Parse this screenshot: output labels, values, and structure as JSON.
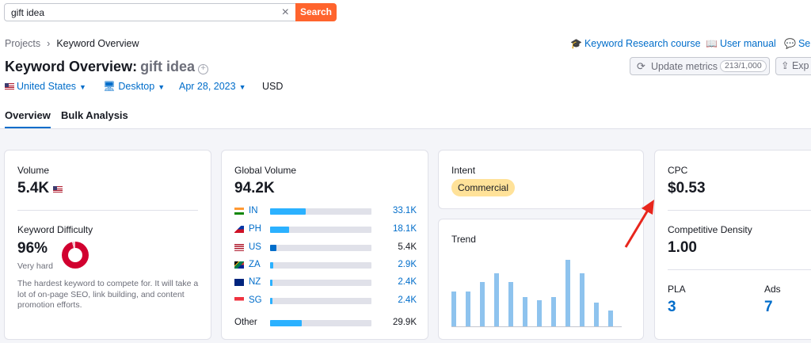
{
  "search": {
    "query": "gift idea",
    "button": "Search"
  },
  "breadcrumb": {
    "root": "Projects",
    "current": "Keyword Overview"
  },
  "top_links": {
    "course": "Keyword Research course",
    "manual": "User manual",
    "send": "Ser"
  },
  "title": {
    "prefix": "Keyword Overview:",
    "keyword": "gift idea"
  },
  "actions": {
    "update_label": "Update metrics",
    "update_count": "213/1,000",
    "export_label": "Exp"
  },
  "filters": {
    "country": "United States",
    "device": "Desktop",
    "date": "Apr 28, 2023",
    "currency": "USD"
  },
  "tabs": [
    {
      "label": "Overview"
    },
    {
      "label": "Bulk Analysis"
    }
  ],
  "volume": {
    "label": "Volume",
    "value": "5.4K"
  },
  "kd": {
    "label": "Keyword Difficulty",
    "value": "96%",
    "level": "Very hard",
    "percent": 96,
    "description": "The hardest keyword to compete for. It will take a lot of on-page SEO, link building, and content promotion efforts."
  },
  "global_volume": {
    "label": "Global Volume",
    "value": "94.2K",
    "rows": [
      {
        "code": "IN",
        "value": "33.1K",
        "share": 0.35
      },
      {
        "code": "PH",
        "value": "18.1K",
        "share": 0.19
      },
      {
        "code": "US",
        "value": "5.4K",
        "share": 0.06
      },
      {
        "code": "ZA",
        "value": "2.9K",
        "share": 0.03
      },
      {
        "code": "NZ",
        "value": "2.4K",
        "share": 0.025
      },
      {
        "code": "SG",
        "value": "2.4K",
        "share": 0.025
      }
    ],
    "other": {
      "label": "Other",
      "value": "29.9K",
      "share": 0.31
    }
  },
  "intent": {
    "label": "Intent",
    "badge": "Commercial"
  },
  "trend": {
    "label": "Trend",
    "values": [
      0.49,
      0.49,
      0.62,
      0.75,
      0.62,
      0.41,
      0.37,
      0.41,
      0.93,
      0.75,
      0.33,
      0.22
    ]
  },
  "cpc": {
    "label": "CPC",
    "value": "$0.53"
  },
  "competitive_density": {
    "label": "Competitive Density",
    "value": "1.00"
  },
  "pla": {
    "label": "PLA",
    "value": "3"
  },
  "ads": {
    "label": "Ads",
    "value": "7"
  },
  "colors": {
    "accent": "#006dca",
    "search": "#ff642d",
    "kd_red": "#d1002f",
    "bar_blue": "#2bb1ff",
    "arrow_red": "#e8261d"
  }
}
